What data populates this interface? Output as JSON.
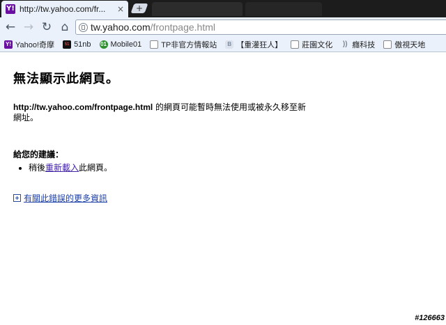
{
  "tab": {
    "favicon": "Y!",
    "title": "http://tw.yahoo.com/fr...",
    "close": "×",
    "new_tab": "+"
  },
  "toolbar": {
    "back_icon": "←",
    "forward_icon": "→",
    "reload_icon": "↻",
    "home_icon": "⌂",
    "url_host": "tw.yahoo.com",
    "url_path": "/frontpage.html"
  },
  "bookmarks": [
    {
      "label": "Yahoo!奇摩",
      "icon": "yahoo-icon",
      "glyph": "Y!"
    },
    {
      "label": "51nb",
      "icon": "51nb-icon",
      "glyph": "51"
    },
    {
      "label": "Mobile01",
      "icon": "mobile01-icon",
      "glyph": "01"
    },
    {
      "label": "TP非官方情報站",
      "icon": "page-icon",
      "glyph": ""
    },
    {
      "label": "【重灌狂人】",
      "icon": "blogger-icon",
      "glyph": "B"
    },
    {
      "label": "莊園文化",
      "icon": "page-icon",
      "glyph": ""
    },
    {
      "label": "癮科技",
      "icon": "rss-icon",
      "glyph": "))"
    },
    {
      "label": "傲視天地",
      "icon": "page-icon",
      "glyph": ""
    }
  ],
  "error": {
    "heading": "無法顯示此網頁。",
    "url_bold": "http://tw.yahoo.com/frontpage.html",
    "message": " 的網頁可能暫時無法使用或被永久移至新網址。",
    "suggestions_title": "給您的建議：",
    "suggestion_prefix": "稍後",
    "suggestion_link": "重新載入",
    "suggestion_suffix": "此網頁。",
    "more_info_link": "有關此錯誤的更多資訊"
  },
  "watermark": "#126663",
  "colors": {
    "chrome_frame": "#1c1c1c",
    "toolbar_bg": "#eaf1fb",
    "link_visited": "#4323a6",
    "link": "#1a3ea8"
  }
}
